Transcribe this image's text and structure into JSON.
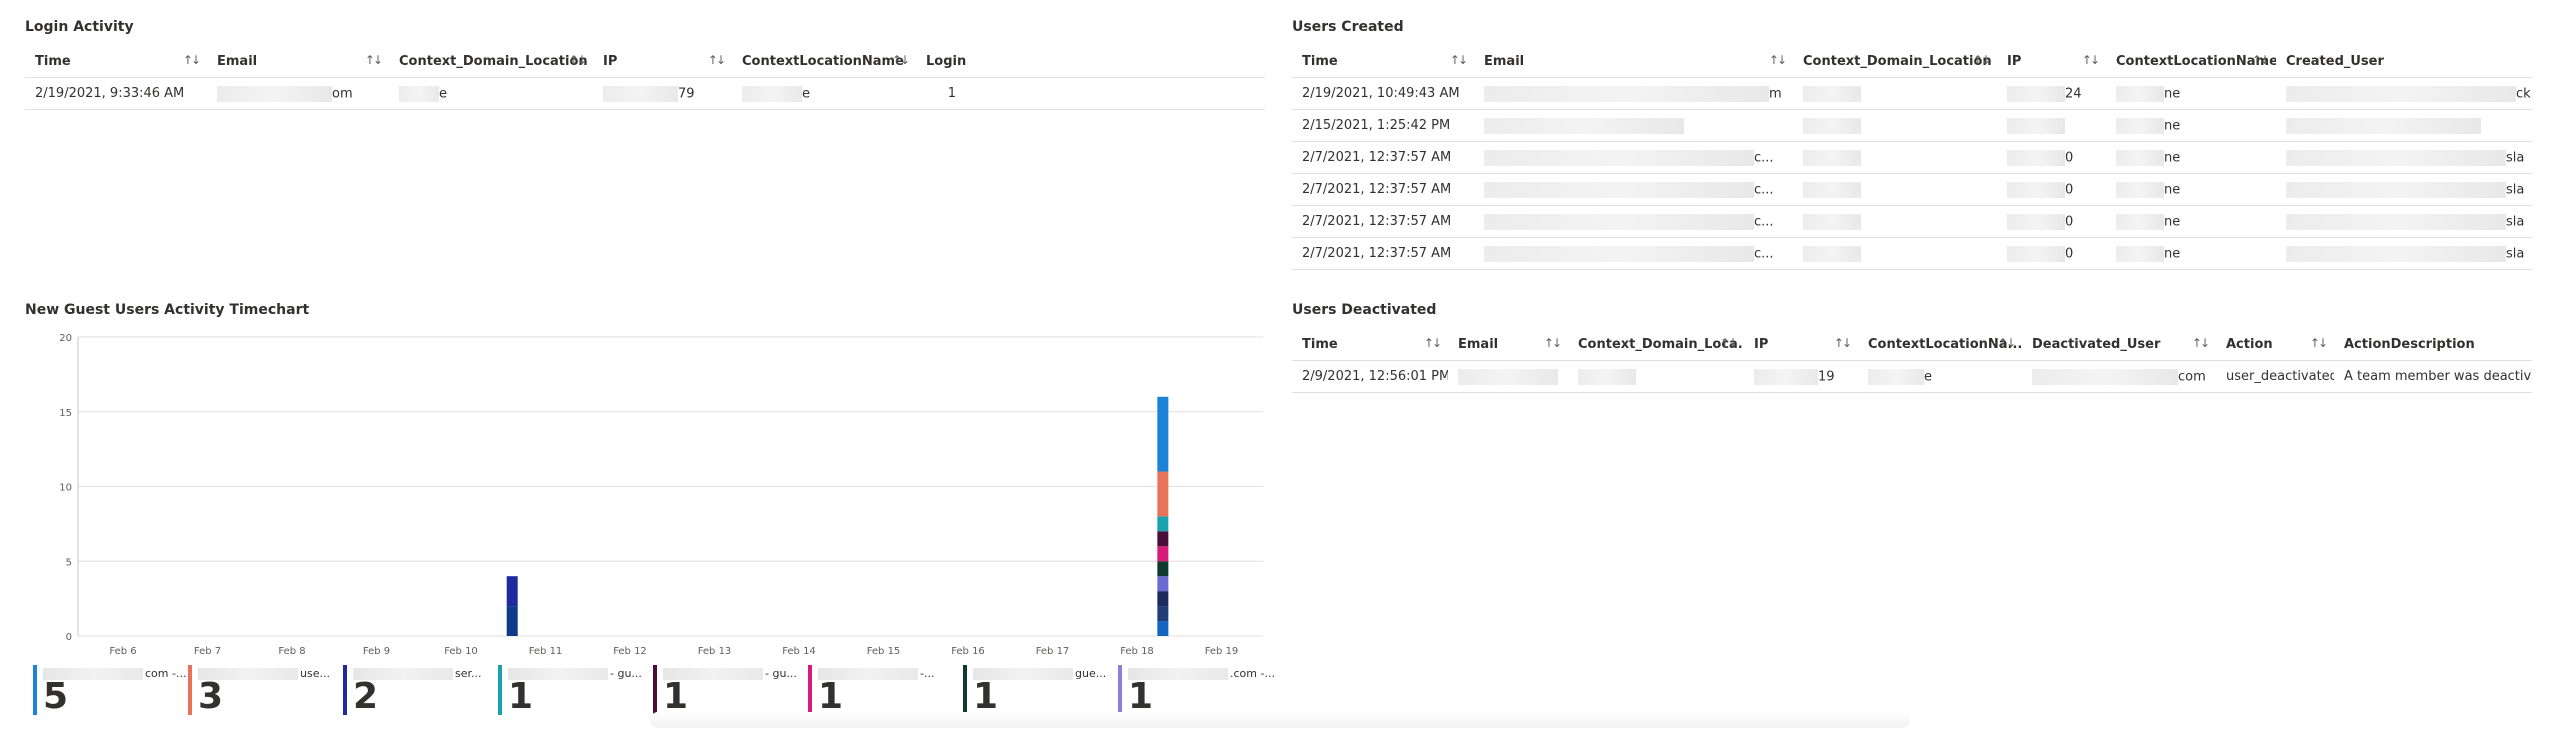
{
  "login_activity": {
    "title": "Login Activity",
    "columns": [
      "Time",
      "Email",
      "Context_Domain_Location",
      "IP",
      "ContextLocationName",
      "Login"
    ],
    "rows": [
      {
        "time": "2/19/2021, 9:33:46 AM",
        "email_tail": "om",
        "domain_tail": "e",
        "ip_tail": "79",
        "loc_tail": "e",
        "login": "1"
      }
    ]
  },
  "users_created": {
    "title": "Users Created",
    "columns": [
      "Time",
      "Email",
      "Context_Domain_Location",
      "IP",
      "ContextLocationName",
      "Created_User"
    ],
    "rows": [
      {
        "time": "2/19/2021, 10:49:43 AM",
        "email_tail": "m",
        "ip_tail": "24",
        "loc_tail": "ne",
        "user_tail": "ck"
      },
      {
        "time": "2/15/2021, 1:25:42 PM",
        "email_tail": "",
        "ip_tail": "",
        "loc_tail": "ne",
        "user_tail": ""
      },
      {
        "time": "2/7/2021, 12:37:57 AM",
        "email_tail": "c...",
        "ip_tail": "0",
        "loc_tail": "ne",
        "user_tail": "sla"
      },
      {
        "time": "2/7/2021, 12:37:57 AM",
        "email_tail": "c...",
        "ip_tail": "0",
        "loc_tail": "ne",
        "user_tail": "sla"
      },
      {
        "time": "2/7/2021, 12:37:57 AM",
        "email_tail": "c...",
        "ip_tail": "0",
        "loc_tail": "ne",
        "user_tail": "sla"
      },
      {
        "time": "2/7/2021, 12:37:57 AM",
        "email_tail": "c...",
        "ip_tail": "0",
        "loc_tail": "ne",
        "user_tail": "sla"
      }
    ]
  },
  "users_deactivated": {
    "title": "Users Deactivated",
    "columns": [
      "Time",
      "Email",
      "Context_Domain_Loca...",
      "IP",
      "ContextLocationNa...",
      "Deactivated_User",
      "Action",
      "ActionDescription"
    ],
    "rows": [
      {
        "time": "2/9/2021, 12:56:01 PM",
        "ip_tail": "19",
        "loc_tail": "e",
        "user_tail": "com",
        "action": "user_deactivated",
        "description": "A team member was deactivatec"
      }
    ]
  },
  "chart_panel_title": "New Guest Users Activity Timechart",
  "chart_data": {
    "type": "bar",
    "stacked": true,
    "ylim": [
      0,
      20
    ],
    "yticks": [
      "0",
      "5",
      "10",
      "15",
      "20"
    ],
    "grid": true,
    "categories": [
      "Feb 6",
      "Feb 7",
      "Feb 8",
      "Feb 9",
      "Feb 10",
      "Feb 11",
      "Feb 12",
      "Feb 13",
      "Feb 14",
      "Feb 15",
      "Feb 16",
      "Feb 17",
      "Feb 18",
      "Feb 19"
    ],
    "bars": [
      {
        "day_offset": 4.6,
        "segments": [
          {
            "value": 2,
            "color": "#0e3a8a"
          },
          {
            "value": 2,
            "color": "#1f2a9e"
          }
        ]
      },
      {
        "day_offset": 12.3,
        "segments": [
          {
            "value": 1,
            "color": "#1565c0"
          },
          {
            "value": 1,
            "color": "#213e78"
          },
          {
            "value": 1,
            "color": "#1b2b5e"
          },
          {
            "value": 1,
            "color": "#6b6bd6"
          },
          {
            "value": 1,
            "color": "#0f3b2e"
          },
          {
            "value": 1,
            "color": "#d81b7a"
          },
          {
            "value": 1,
            "color": "#4a0e3a"
          },
          {
            "value": 1,
            "color": "#19a3b0"
          },
          {
            "value": 3,
            "color": "#e8735a"
          },
          {
            "value": 5,
            "color": "#1c83d8"
          }
        ]
      }
    ],
    "legend": [
      {
        "count": "5",
        "suffix": "com -...",
        "color": "#1c83d8"
      },
      {
        "count": "3",
        "suffix": "use...",
        "color": "#e8735a"
      },
      {
        "count": "2",
        "suffix": "ser...",
        "color": "#1f2a9e"
      },
      {
        "count": "1",
        "suffix": "- gu...",
        "color": "#19a3b0"
      },
      {
        "count": "1",
        "suffix": "- gu...",
        "color": "#4a0e3a"
      },
      {
        "count": "1",
        "suffix": "-...",
        "color": "#d81b7a"
      },
      {
        "count": "1",
        "suffix": "gue...",
        "color": "#0f3b2e"
      },
      {
        "count": "1",
        "suffix": ".com -...",
        "color": "#8a7fe0"
      }
    ]
  }
}
